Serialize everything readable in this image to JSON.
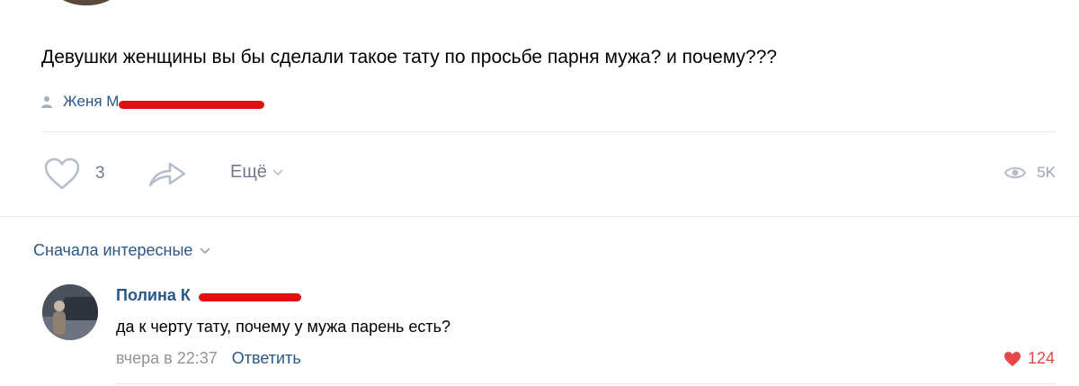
{
  "post": {
    "text": "Девушки женщины вы бы сделали такое тату по просьбе парня мужа? и почему???",
    "author_name": "Женя М"
  },
  "actions": {
    "like_icon": "heart-outline-icon",
    "like_count": "3",
    "share_icon": "share-arrow-icon",
    "more_label": "Ещё",
    "views_icon": "eye-icon",
    "views_count": "5K"
  },
  "comments": {
    "sort_label": "Сначала интересные",
    "items": [
      {
        "author": "Полина К",
        "text": "да к черту тату, почему у мужа парень есть?",
        "time": "вчера в 22:37",
        "reply_label": "Ответить",
        "likes": "124"
      }
    ]
  },
  "colors": {
    "link": "#2a5885",
    "muted": "#939393",
    "like_active": "#e64646",
    "redaction": "#e01010"
  }
}
